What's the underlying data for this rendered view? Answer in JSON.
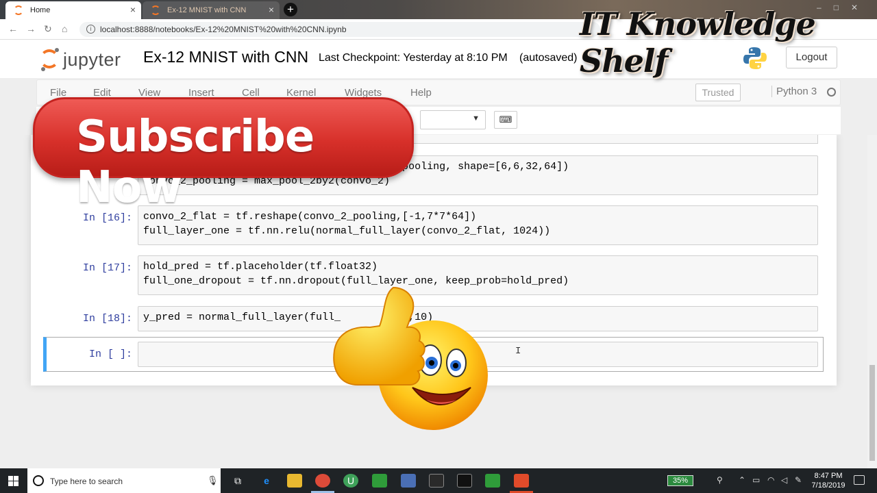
{
  "browser": {
    "tabs": [
      {
        "label": "Home",
        "active": true
      },
      {
        "label": "Ex-12 MNIST with CNN",
        "active": false
      }
    ],
    "new_tab": "+",
    "url": "localhost:8888/notebooks/Ex-12%20MNIST%20with%20CNN.ipynb"
  },
  "jupyter": {
    "logo_text": "jupyter",
    "notebook_title": "Ex-12 MNIST with CNN",
    "checkpoint": "Last Checkpoint: Yesterday at 8:10 PM",
    "autosaved": "(autosaved)",
    "logout": "Logout",
    "menu": [
      "File",
      "Edit",
      "View",
      "Insert",
      "Cell",
      "Kernel",
      "Widgets",
      "Help"
    ],
    "trusted": "Trusted",
    "kernel": "Python 3",
    "celltype_caret": "▼",
    "keyboard_icon": "⌨"
  },
  "cells": [
    {
      "prompt": "",
      "code": "                                         _pooling, shape=[6,6,32,64])\nconvo_2_pooling = max_pool_2by2(convo_2)"
    },
    {
      "prompt": "In [16]:",
      "code": "convo_2_flat = tf.reshape(convo_2_pooling,[-1,7*7*64])\nfull_layer_one = tf.nn.relu(normal_full_layer(convo_2_flat, 1024))"
    },
    {
      "prompt": "In [17]:",
      "code": "hold_pred = tf.placeholder(tf.float32)\nfull_one_dropout = tf.nn.dropout(full_layer_one, keep_prob=hold_pred)"
    },
    {
      "prompt": "In [18]:",
      "code": "y_pred = normal_full_layer(full_         ut,10)"
    },
    {
      "prompt": "In [ ]:",
      "code": ""
    }
  ],
  "overlay": {
    "subscribe": "Subscribe Now",
    "brand": "IT Knowledge Shelf"
  },
  "taskbar": {
    "search_placeholder": "Type here to search",
    "battery": "35%",
    "time": "8:47 PM",
    "date": "7/18/2019"
  },
  "colors": {
    "jupyter_orange": "#f37626",
    "prompt_blue": "#303f9f",
    "selected_cell": "#42a5f5",
    "subscribe_red": "#d7302a"
  }
}
